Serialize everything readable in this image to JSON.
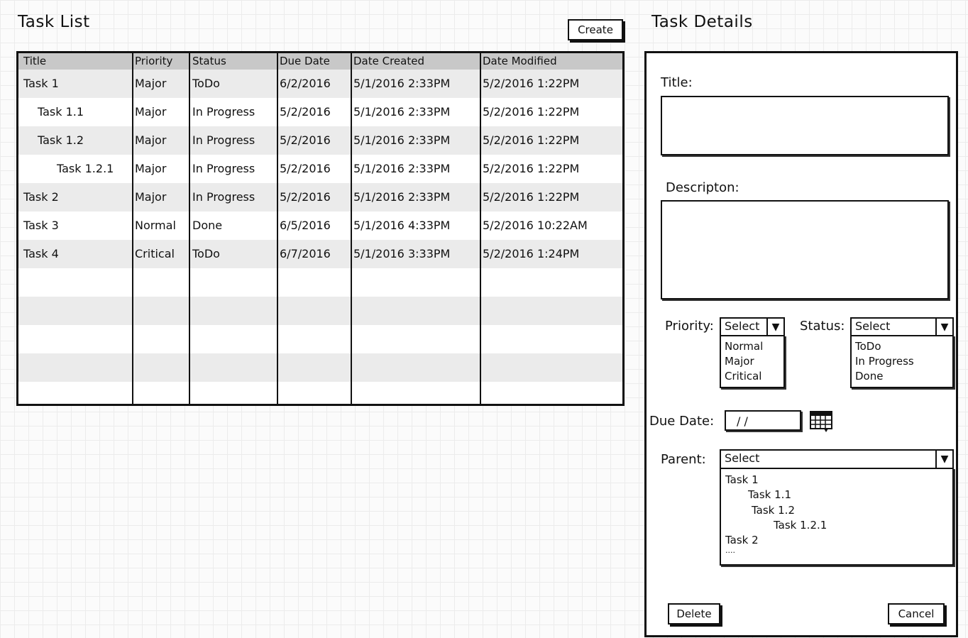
{
  "task_list": {
    "title": "Task List",
    "create_label": "Create",
    "columns": [
      "Title",
      "Priority",
      "Status",
      "Due Date",
      "Date Created",
      "Date Modified"
    ],
    "rows": [
      {
        "title": "Task 1",
        "priority": "Major",
        "status": "ToDo",
        "due": "6/2/2016",
        "created": "5/1/2016 2:33PM",
        "modified": "5/2/2016 1:22PM"
      },
      {
        "title": "Task 1.1",
        "priority": "Major",
        "status": "In Progress",
        "due": "5/2/2016",
        "created": "5/1/2016 2:33PM",
        "modified": "5/2/2016 1:22PM"
      },
      {
        "title": "Task 1.2",
        "priority": "Major",
        "status": "In Progress",
        "due": "5/2/2016",
        "created": "5/1/2016 2:33PM",
        "modified": "5/2/2016 1:22PM"
      },
      {
        "title": "Task 1.2.1",
        "priority": "Major",
        "status": "In Progress",
        "due": "5/2/2016",
        "created": "5/1/2016 2:33PM",
        "modified": "5/2/2016 1:22PM"
      },
      {
        "title": "Task 2",
        "priority": "Major",
        "status": "In Progress",
        "due": "5/2/2016",
        "created": "5/1/2016 2:33PM",
        "modified": "5/2/2016 1:22PM"
      },
      {
        "title": "Task 3",
        "priority": "Normal",
        "status": "Done",
        "due": "6/5/2016",
        "created": "5/1/2016 4:33PM",
        "modified": "5/2/2016 10:22AM"
      },
      {
        "title": "Task 4",
        "priority": "Critical",
        "status": "ToDo",
        "due": "6/7/2016",
        "created": "5/1/2016 3:33PM",
        "modified": "5/2/2016 1:24PM"
      }
    ]
  },
  "details": {
    "title": "Task Details",
    "title_label": "Title:",
    "description_label": "Descripton:",
    "priority_label": "Priority:",
    "priority_select": "Select",
    "priority_options": [
      "Normal",
      "Major",
      "Critical"
    ],
    "status_label": "Status:",
    "status_select": "Select",
    "status_options": [
      "ToDo",
      "In Progress",
      "Done"
    ],
    "due_date_label": "Due Date:",
    "due_date_value": "/ /",
    "parent_label": "Parent:",
    "parent_select": "Select",
    "parent_options": [
      "Task 1",
      "Task 1.1",
      "Task 1.2",
      "Task 1.2.1",
      "Task 2",
      "...."
    ],
    "delete_label": "Delete",
    "cancel_label": "Cancel"
  },
  "icons": {
    "calendar": "calendar-icon",
    "dropdown": "chevron-down-icon"
  },
  "colors": {
    "header": "#c8c8c8",
    "alt_row": "#ebebeb",
    "border": "#111111"
  }
}
